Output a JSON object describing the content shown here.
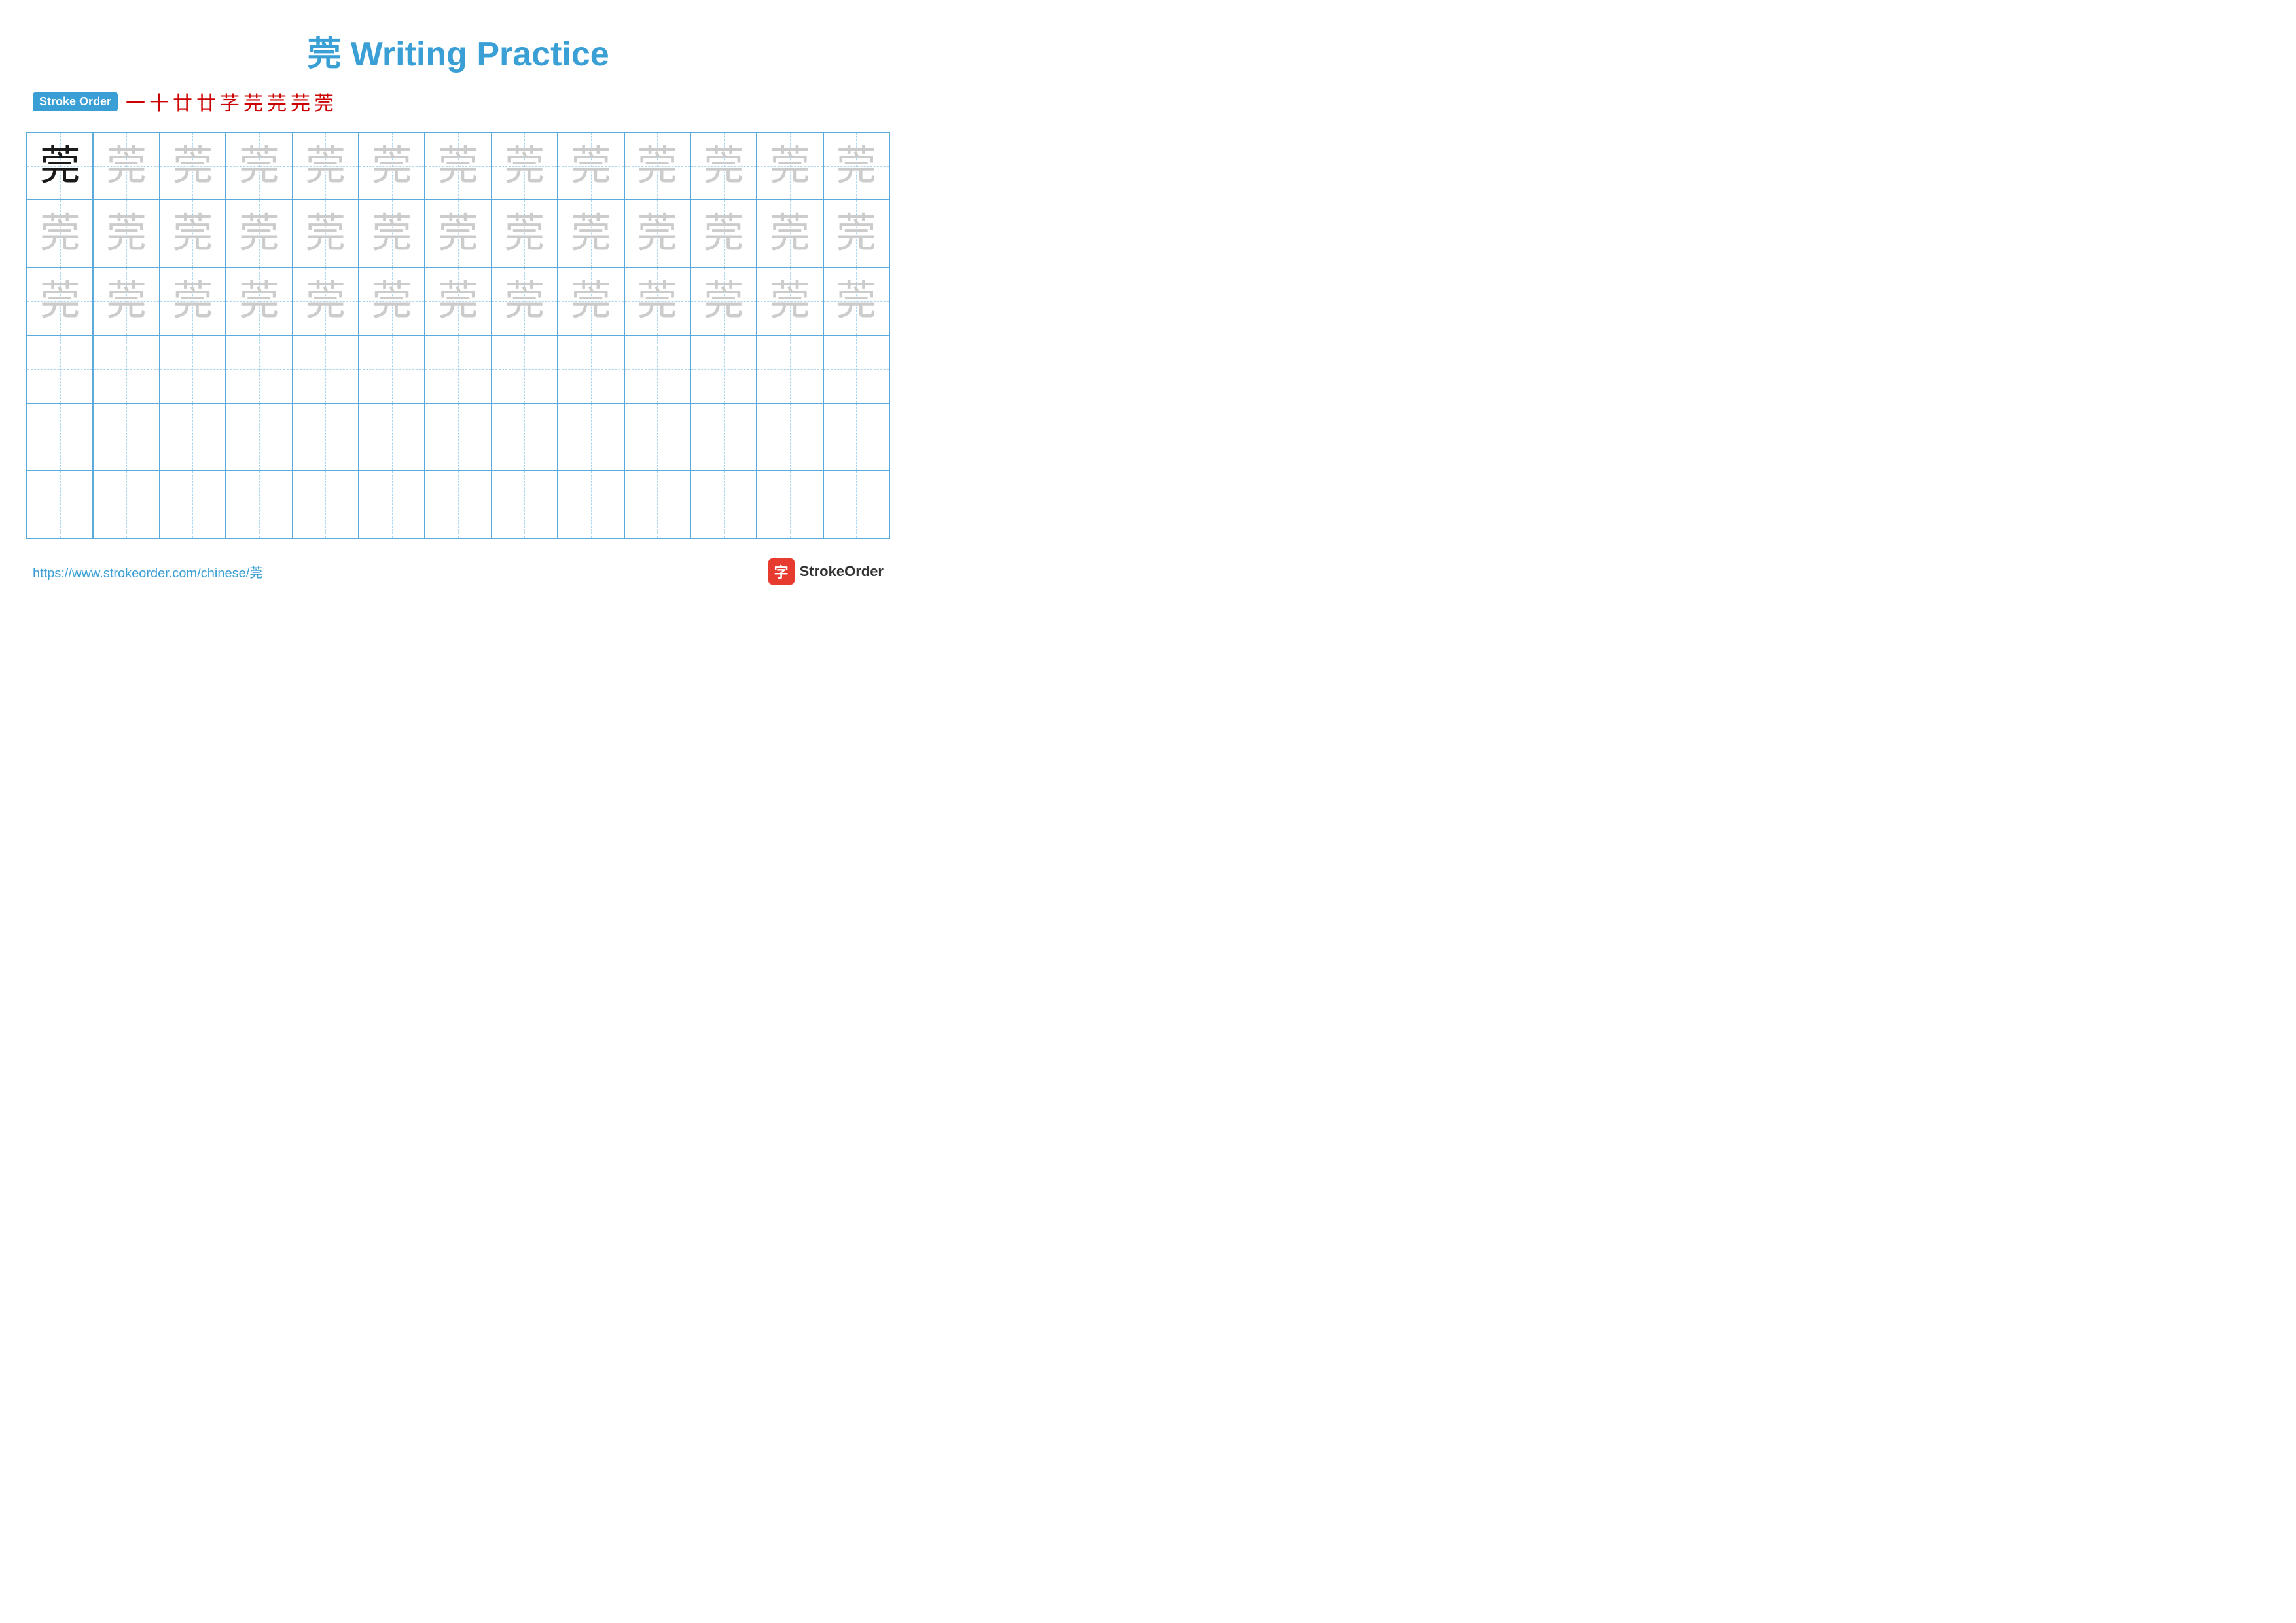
{
  "title": "莞 Writing Practice",
  "stroke_order": {
    "badge_label": "Stroke Order",
    "strokes": [
      "一",
      "十",
      "廿",
      "廿",
      "芓",
      "芫",
      "芫",
      "芫",
      "莞"
    ]
  },
  "grid": {
    "rows": 6,
    "cols": 13,
    "char": "莞",
    "filled_rows": [
      {
        "type": "dark_first_light_rest",
        "dark_count": 1,
        "light_count": 12
      },
      {
        "type": "all_light"
      },
      {
        "type": "all_light"
      },
      {
        "type": "empty"
      },
      {
        "type": "empty"
      },
      {
        "type": "empty"
      }
    ]
  },
  "footer": {
    "url": "https://www.strokeorder.com/chinese/莞",
    "brand_char": "字",
    "brand_name": "StrokeOrder"
  }
}
